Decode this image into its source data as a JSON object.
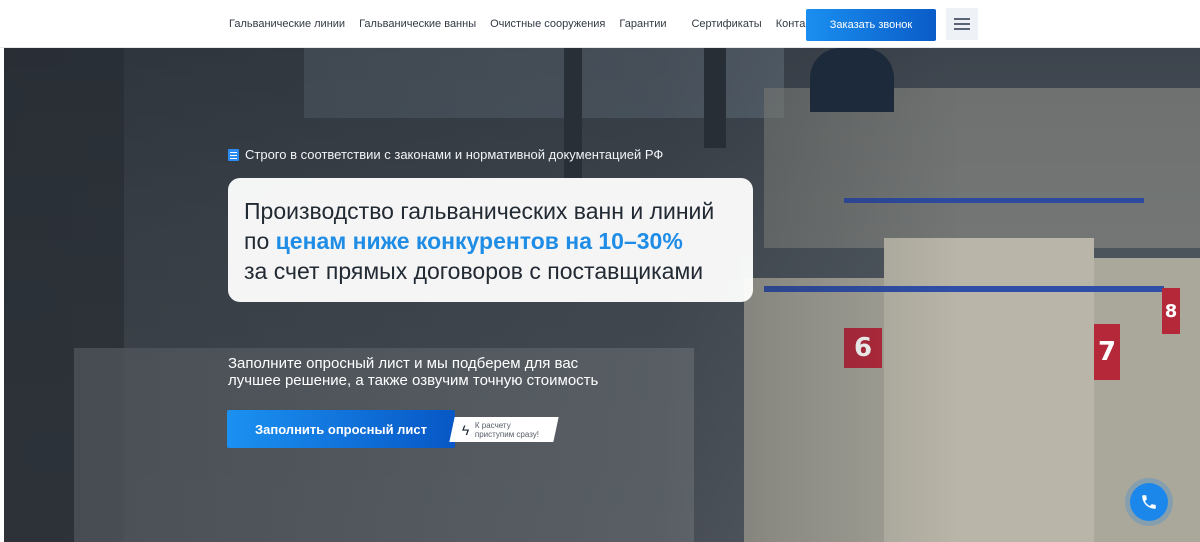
{
  "nav": {
    "items": [
      "Гальванические линии",
      "Гальванические ванны",
      "Очистные сооружения",
      "Гарантии",
      "Сертификаты",
      "Контакты"
    ],
    "call_button": "Заказать звонок"
  },
  "hero": {
    "tagline": "Строго в соответствии с законами и нормативной документацией РФ",
    "headline": {
      "line1": "Производство гальванических ванн и линий",
      "line2_prefix": "по",
      "line2_accent": "ценам ниже конкурентов на 10–30%",
      "line3": "за счет прямых договоров с поставщиками"
    },
    "subtext": {
      "line1": "Заполните опросный лист и мы подберем для вас",
      "line2": "лучшее решение, а также озвучим точную стоимость"
    },
    "cta_label": "Заполнить опросный лист",
    "cta_note": {
      "line1": "К расчету",
      "line2": "приступим сразу!"
    },
    "tank_numbers": [
      "6",
      "7",
      "8"
    ]
  },
  "colors": {
    "accent": "#1f8de6",
    "button_gradient_start": "#1b91f2",
    "button_gradient_end": "#0757c5"
  },
  "icons": {
    "tagline_icon": "document-icon",
    "cta_note_icon": "lightning-icon",
    "floating_button_icon": "phone-icon",
    "menu_icon": "hamburger-menu-icon"
  }
}
